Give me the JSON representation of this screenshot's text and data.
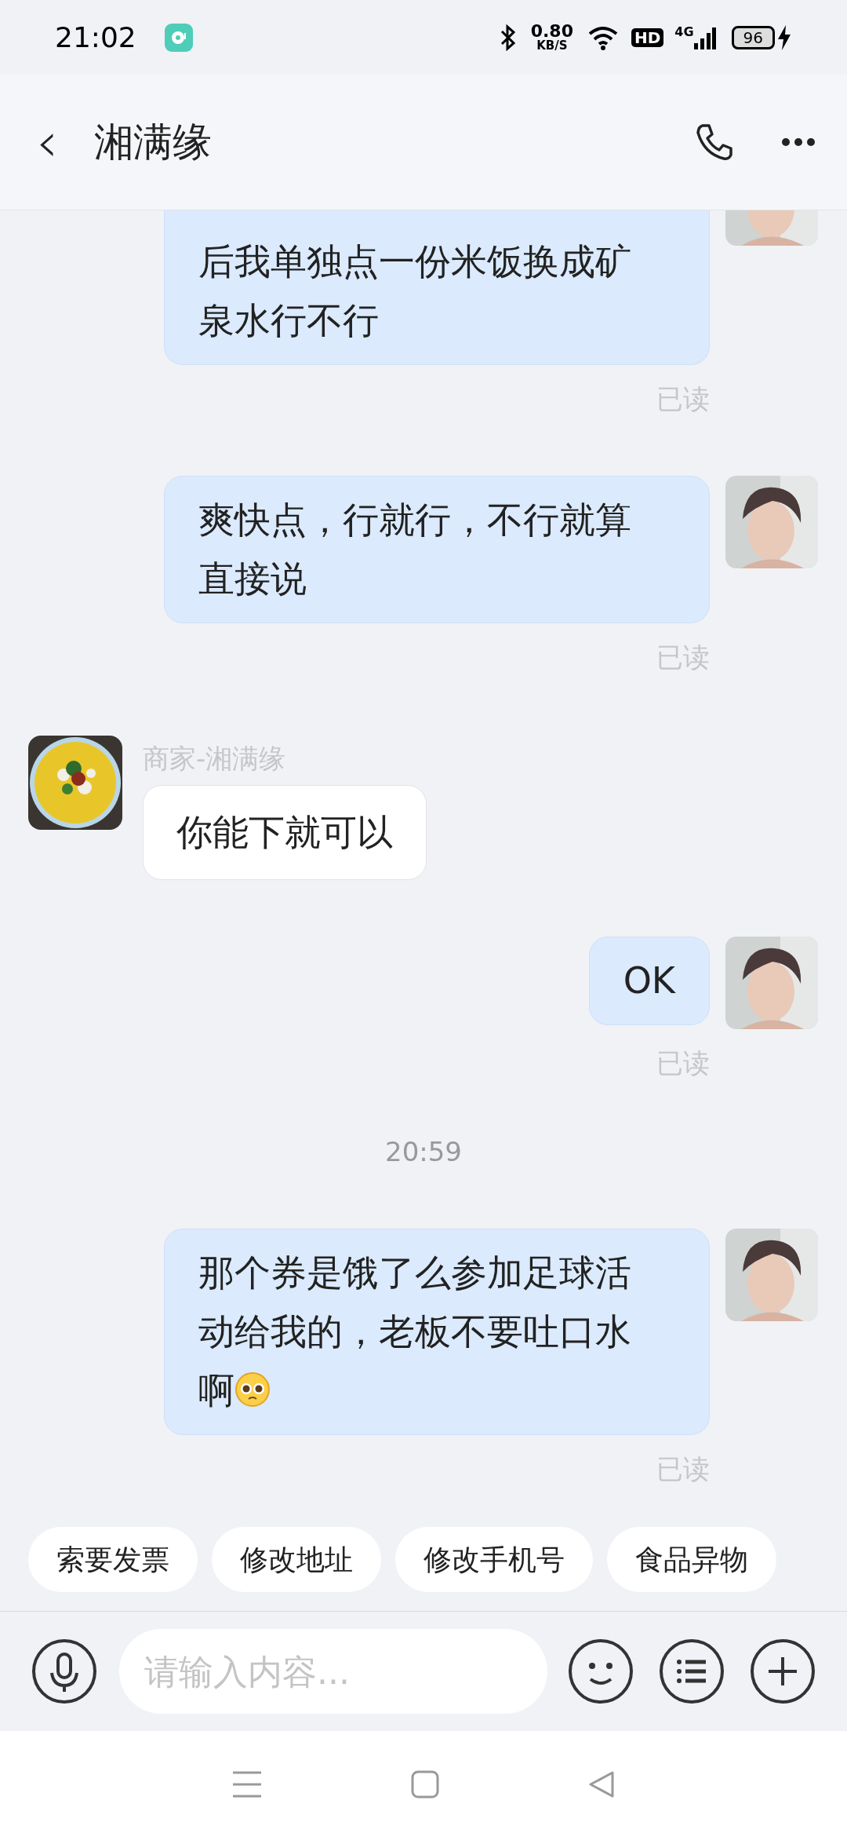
{
  "status_bar": {
    "time": "21:02",
    "speed_value": "0.80",
    "speed_unit": "KB/S",
    "hd": "HD",
    "network": "4G",
    "battery": "96"
  },
  "header": {
    "back": "‹",
    "title": "湘满缘"
  },
  "messages": [
    {
      "kind": "sent",
      "text": "后我单独点一份米饭换成矿泉水行不行",
      "cut_top": true,
      "emoji": false,
      "read": "已读"
    },
    {
      "kind": "sent",
      "text": "爽快点，行就行，不行就算直接说",
      "cut_top": false,
      "emoji": false,
      "read": "已读"
    },
    {
      "kind": "received",
      "sender": "商家-湘满缘",
      "text": "你能下就可以"
    },
    {
      "kind": "sent",
      "text": "OK",
      "cut_top": false,
      "emoji": false,
      "read": "已读"
    },
    {
      "kind": "time",
      "text": "20:59"
    },
    {
      "kind": "sent",
      "text": "那个券是饿了么参加足球活动给我的，老板不要吐口水啊",
      "cut_top": false,
      "emoji": true,
      "read": "已读"
    }
  ],
  "quick_replies": [
    "索要发票",
    "修改地址",
    "修改手机号",
    "食品异物"
  ],
  "composer": {
    "placeholder": "请输入内容..."
  }
}
